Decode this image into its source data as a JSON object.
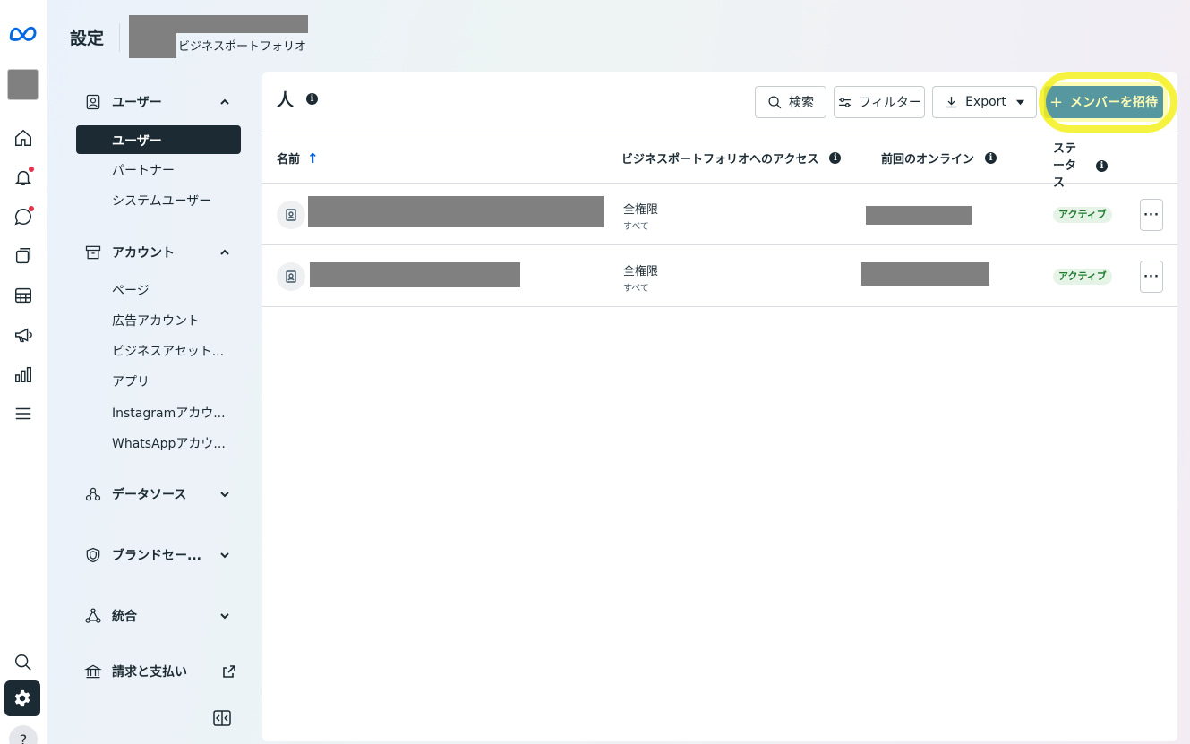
{
  "header": {
    "title": "設定",
    "portfolio_suffix": "ビジネスポートフォリオ"
  },
  "rail": {
    "icons": [
      "meta-logo-icon",
      "home-icon",
      "bell-icon",
      "chat-icon",
      "pages-icon",
      "table-icon",
      "megaphone-icon",
      "chart-icon",
      "menu-icon",
      "search-icon",
      "gear-icon",
      "help-icon"
    ],
    "help_label": "?"
  },
  "sidebar": {
    "users_section": "ユーザー",
    "users_items": [
      "ユーザー",
      "パートナー",
      "システムユーザー"
    ],
    "accounts_section": "アカウント",
    "accounts_items": [
      "ページ",
      "広告アカウント",
      "ビジネスアセット...",
      "アプリ",
      "Instagramアカウ...",
      "WhatsAppアカウ..."
    ],
    "data_sources": "データソース",
    "brand_safety": "ブランドセー...",
    "integrations": "統合",
    "billing": "請求と支払い"
  },
  "main": {
    "title": "人",
    "search_label": "検索",
    "filter_label": "フィルター",
    "export_label": "Export",
    "invite_label": "メンバーを招待",
    "invite_plus": "+",
    "columns": {
      "name": "名前",
      "sort_arrow": "↑",
      "access": "ビジネスポートフォリオへのアクセス",
      "last_online": "前回のオンライン",
      "status": "ステータス"
    },
    "rows": [
      {
        "access": "全権限",
        "access_sub": "すべて",
        "status": "アクティブ",
        "more": "···"
      },
      {
        "access": "全権限",
        "access_sub": "すべて",
        "status": "アクティブ",
        "more": "···"
      }
    ]
  },
  "colors": {
    "primary": "#0064e0",
    "dark": "#1c2b33",
    "highlight": "#f5f01e",
    "active_badge": "#1f7a2e"
  }
}
